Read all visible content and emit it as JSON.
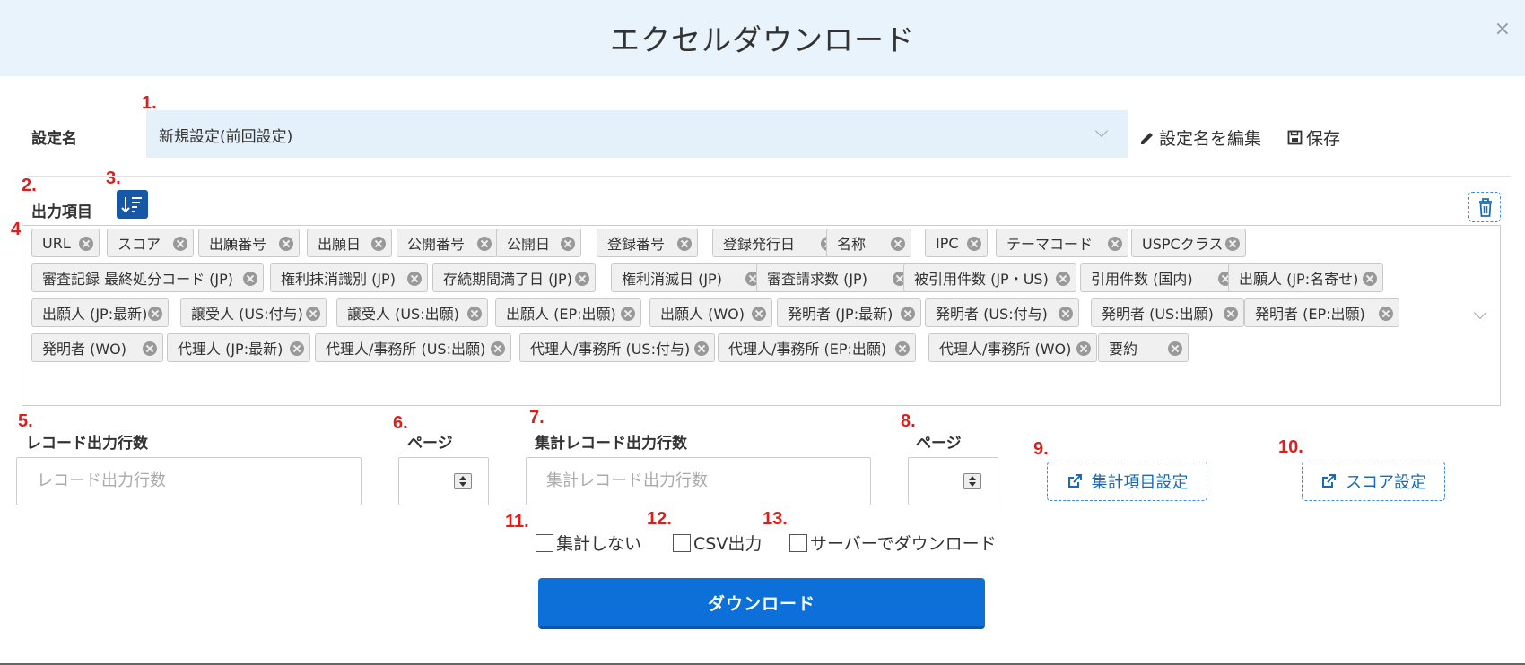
{
  "title": "エクセルダウンロード",
  "close_label": "×",
  "markers": [
    "1.",
    "2.",
    "3.",
    "4.",
    "5.",
    "6.",
    "7.",
    "8.",
    "9.",
    "10.",
    "11.",
    "12.",
    "13."
  ],
  "setting": {
    "label": "設定名",
    "value": "新規設定(前回設定)",
    "edit_label": "設定名を編集",
    "save_label": "保存"
  },
  "output_items": {
    "label": "出力項目",
    "tags": [
      "URL",
      "スコア",
      "出願番号",
      "出願日",
      "公開番号",
      "公開日",
      "登録番号",
      "登録発行日",
      "名称",
      "IPC",
      "テーマコード",
      "USPCクラス",
      "審査記録 最終処分コード (JP)",
      "権利抹消識別 (JP)",
      "存続期間満了日 (JP)",
      "権利消滅日 (JP)",
      "審査請求数 (JP)",
      "被引用件数 (JP・US)",
      "引用件数 (国内)",
      "出願人 (JP:名寄せ)",
      "出願人 (JP:最新)",
      "譲受人 (US:付与)",
      "譲受人 (US:出願)",
      "出願人 (EP:出願)",
      "出願人 (WO)",
      "発明者 (JP:最新)",
      "発明者 (US:付与)",
      "発明者 (US:出願)",
      "発明者 (EP:出願)",
      "発明者 (WO)",
      "代理人 (JP:最新)",
      "代理人/事務所 (US:出願)",
      "代理人/事務所 (US:付与)",
      "代理人/事務所 (EP:出願)",
      "代理人/事務所 (WO)",
      "要約"
    ]
  },
  "record_rows": {
    "label": "レコード出力行数",
    "placeholder": "レコード出力行数"
  },
  "page1": {
    "label": "ページ"
  },
  "agg_rows": {
    "label": "集計レコード出力行数",
    "placeholder": "集計レコード出力行数"
  },
  "page2": {
    "label": "ページ"
  },
  "agg_settings_label": "集計項目設定",
  "score_settings_label": "スコア設定",
  "checkboxes": [
    "集計しない",
    "CSV出力",
    "サーバーでダウンロード"
  ],
  "download_label": "ダウンロード",
  "colors": {
    "header_bg": "#e8f3fb",
    "primary": "#0c70d8",
    "marker": "#e21b1b",
    "sort_btn": "#1757a8"
  }
}
